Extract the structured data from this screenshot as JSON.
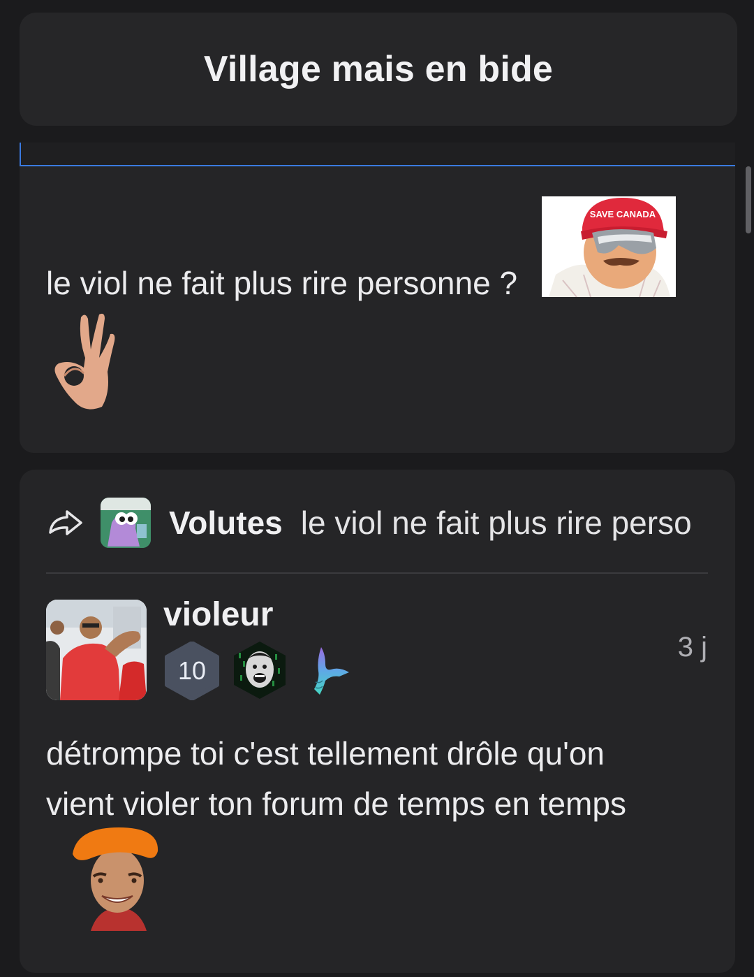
{
  "header": {
    "title": "Village mais en bide"
  },
  "post": {
    "text": "le viol ne fait plus rire personne ?",
    "stickers": [
      "save-canada-sticker",
      "ok-hand-sticker"
    ],
    "canada_cap_text": "SAVE CANADA"
  },
  "reply": {
    "quote": {
      "author": "Volutes",
      "excerpt": "le viol ne fait plus rire perso"
    },
    "author": {
      "username": "violeur",
      "level": "10",
      "badges": [
        "cr7-badge",
        "mermaid-tail-icon"
      ]
    },
    "timestamp": "3 j",
    "text_line1": "détrompe toi c'est tellement drôle qu'on",
    "text_line2": "vient violer ton forum de temps en temps",
    "sticker": "cr7-orange-hat-sticker"
  },
  "colors": {
    "background": "#1b1b1d",
    "card": "#252527",
    "accent_blue": "#3a7ae0",
    "level_badge": "#4a5160"
  }
}
